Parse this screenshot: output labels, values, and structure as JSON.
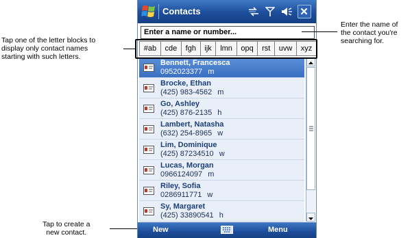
{
  "app": {
    "title": "Contacts",
    "icons": [
      "windows-start-icon",
      "connectivity-icon",
      "signal-icon",
      "volume-icon",
      "close-icon"
    ]
  },
  "search": {
    "placeholder": "Enter a name or number..."
  },
  "letter_tabs": [
    "#ab",
    "cde",
    "fgh",
    "ijk",
    "lmn",
    "opq",
    "rst",
    "uvw",
    "xyz"
  ],
  "contacts": [
    {
      "name": "Bennett, Francesca",
      "phone": "0952023377",
      "type": "m",
      "selected": true
    },
    {
      "name": "Brocke, Ethan",
      "phone": "(425) 983-4562",
      "type": "m"
    },
    {
      "name": "Go, Ashley",
      "phone": "(425) 876-2135",
      "type": "h"
    },
    {
      "name": "Lambert, Natasha",
      "phone": "(632) 254-8965",
      "type": "w"
    },
    {
      "name": "Lim, Dominique",
      "phone": "(425) 87234510",
      "type": "w"
    },
    {
      "name": "Lucas, Morgan",
      "phone": "0966124097",
      "type": "m"
    },
    {
      "name": "Riley, Sofia",
      "phone": "0286911771",
      "type": "w"
    },
    {
      "name": "Sy, Margaret",
      "phone": "(425) 33890541",
      "type": "h"
    }
  ],
  "softkeys": {
    "left": "New",
    "right": "Menu"
  },
  "annotations": {
    "letters": [
      "Tap one of the letter blocks to",
      "display only contact names",
      "starting with such letters."
    ],
    "search": [
      "Enter the name of",
      "the contact you're",
      "searching for."
    ],
    "new": [
      "Tap to create a",
      "new contact."
    ]
  },
  "colors": {
    "title_bar": "#1d4d9a",
    "selected_row": "#3a70c3",
    "list_row": "#e9eff8",
    "name_text": "#1c3e7a"
  }
}
